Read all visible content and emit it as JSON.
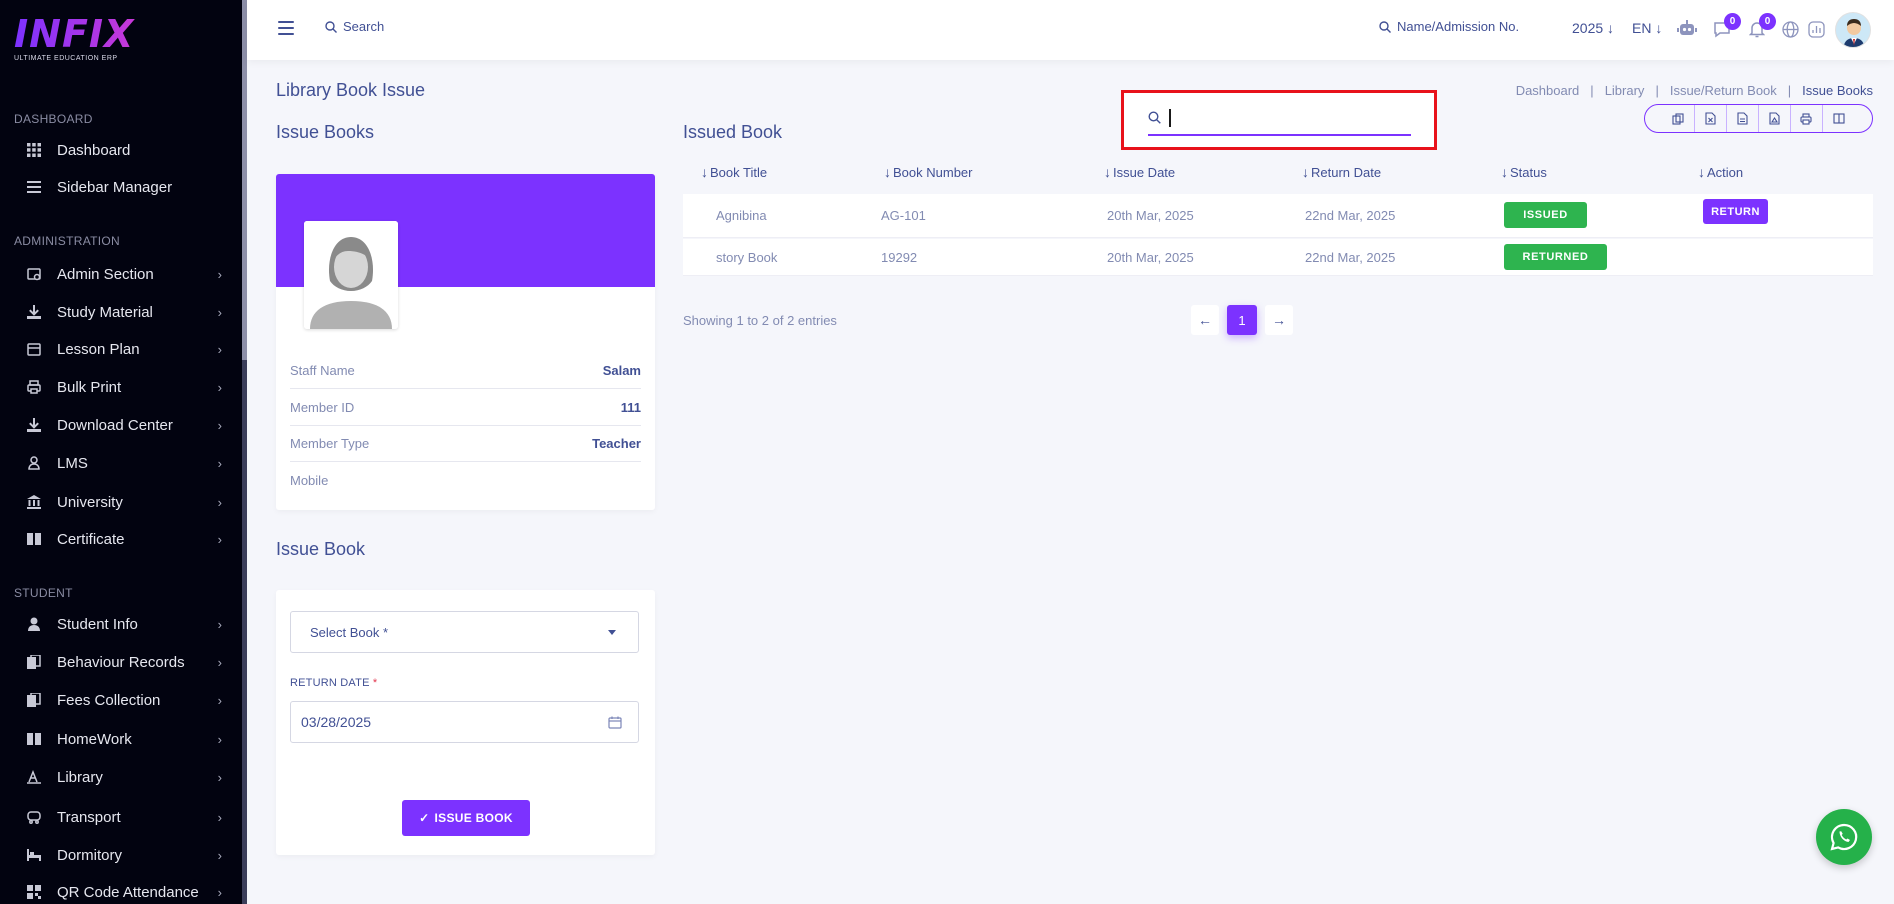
{
  "app": {
    "logo_text": "INFIX",
    "logo_sub": "ULTIMATE EDUCATION ERP"
  },
  "sidebar": {
    "sections": [
      {
        "title": "DASHBOARD",
        "items": [
          {
            "label": "Dashboard",
            "icon": "grid-icon",
            "chevron": false
          },
          {
            "label": "Sidebar Manager",
            "icon": "menu-icon",
            "chevron": false
          }
        ]
      },
      {
        "title": "ADMINISTRATION",
        "items": [
          {
            "label": "Admin Section",
            "icon": "admin-icon",
            "chevron": true
          },
          {
            "label": "Study Material",
            "icon": "download-icon",
            "chevron": true
          },
          {
            "label": "Lesson Plan",
            "icon": "calendar-icon",
            "chevron": true
          },
          {
            "label": "Bulk Print",
            "icon": "printer-icon",
            "chevron": true
          },
          {
            "label": "Download Center",
            "icon": "download-icon",
            "chevron": true
          },
          {
            "label": "LMS",
            "icon": "lms-icon",
            "chevron": true
          },
          {
            "label": "University",
            "icon": "university-icon",
            "chevron": true
          },
          {
            "label": "Certificate",
            "icon": "book-icon",
            "chevron": true
          }
        ]
      },
      {
        "title": "STUDENT",
        "items": [
          {
            "label": "Student Info",
            "icon": "user-icon",
            "chevron": true
          },
          {
            "label": "Behaviour Records",
            "icon": "records-icon",
            "chevron": true
          },
          {
            "label": "Fees Collection",
            "icon": "fees-icon",
            "chevron": true
          },
          {
            "label": "HomeWork",
            "icon": "book-icon",
            "chevron": true
          },
          {
            "label": "Library",
            "icon": "library-icon",
            "chevron": true
          },
          {
            "label": "Transport",
            "icon": "transport-icon",
            "chevron": true
          },
          {
            "label": "Dormitory",
            "icon": "bed-icon",
            "chevron": true
          },
          {
            "label": "QR Code Attendance",
            "icon": "qr-icon",
            "chevron": true
          }
        ]
      }
    ]
  },
  "topbar": {
    "search_label": "Search",
    "admission_search": "Name/Admission No.",
    "year": "2025",
    "lang": "EN",
    "chat_badge": "0",
    "notify_badge": "0"
  },
  "page": {
    "title": "Library Book Issue",
    "breadcrumb": [
      "Dashboard",
      "Library",
      "Issue/Return Book",
      "Issue Books"
    ]
  },
  "issue_books": {
    "heading": "Issue Books",
    "info": [
      {
        "key": "Staff Name",
        "value": "Salam"
      },
      {
        "key": "Member ID",
        "value": "111"
      },
      {
        "key": "Member Type",
        "value": "Teacher"
      },
      {
        "key": "Mobile",
        "value": ""
      }
    ]
  },
  "issue_form": {
    "heading": "Issue Book",
    "select_placeholder": "Select Book *",
    "return_date_label": "RETURN DATE",
    "return_date_req": "*",
    "return_date_value": "03/28/2025",
    "submit_label": "ISSUE BOOK",
    "submit_check": "✓"
  },
  "issued_table": {
    "heading": "Issued Book",
    "columns": [
      "Book Title",
      "Book Number",
      "Issue Date",
      "Return Date",
      "Status",
      "Action"
    ],
    "rows": [
      {
        "title": "Agnibina",
        "number": "AG-101",
        "issue": "20th Mar, 2025",
        "return": "22nd Mar, 2025",
        "status": "ISSUED",
        "action": "RETURN"
      },
      {
        "title": "story Book",
        "number": "19292",
        "issue": "20th Mar, 2025",
        "return": "22nd Mar, 2025",
        "status": "RETURNED",
        "action": ""
      }
    ],
    "showing": "Showing 1 to 2 of 2 entries",
    "page": "1"
  },
  "table_search": {
    "value": ""
  },
  "colors": {
    "accent": "#7c32ff",
    "status_green": "#2eb44f",
    "highlight": "#e8121b",
    "whatsapp": "#25b14a"
  }
}
